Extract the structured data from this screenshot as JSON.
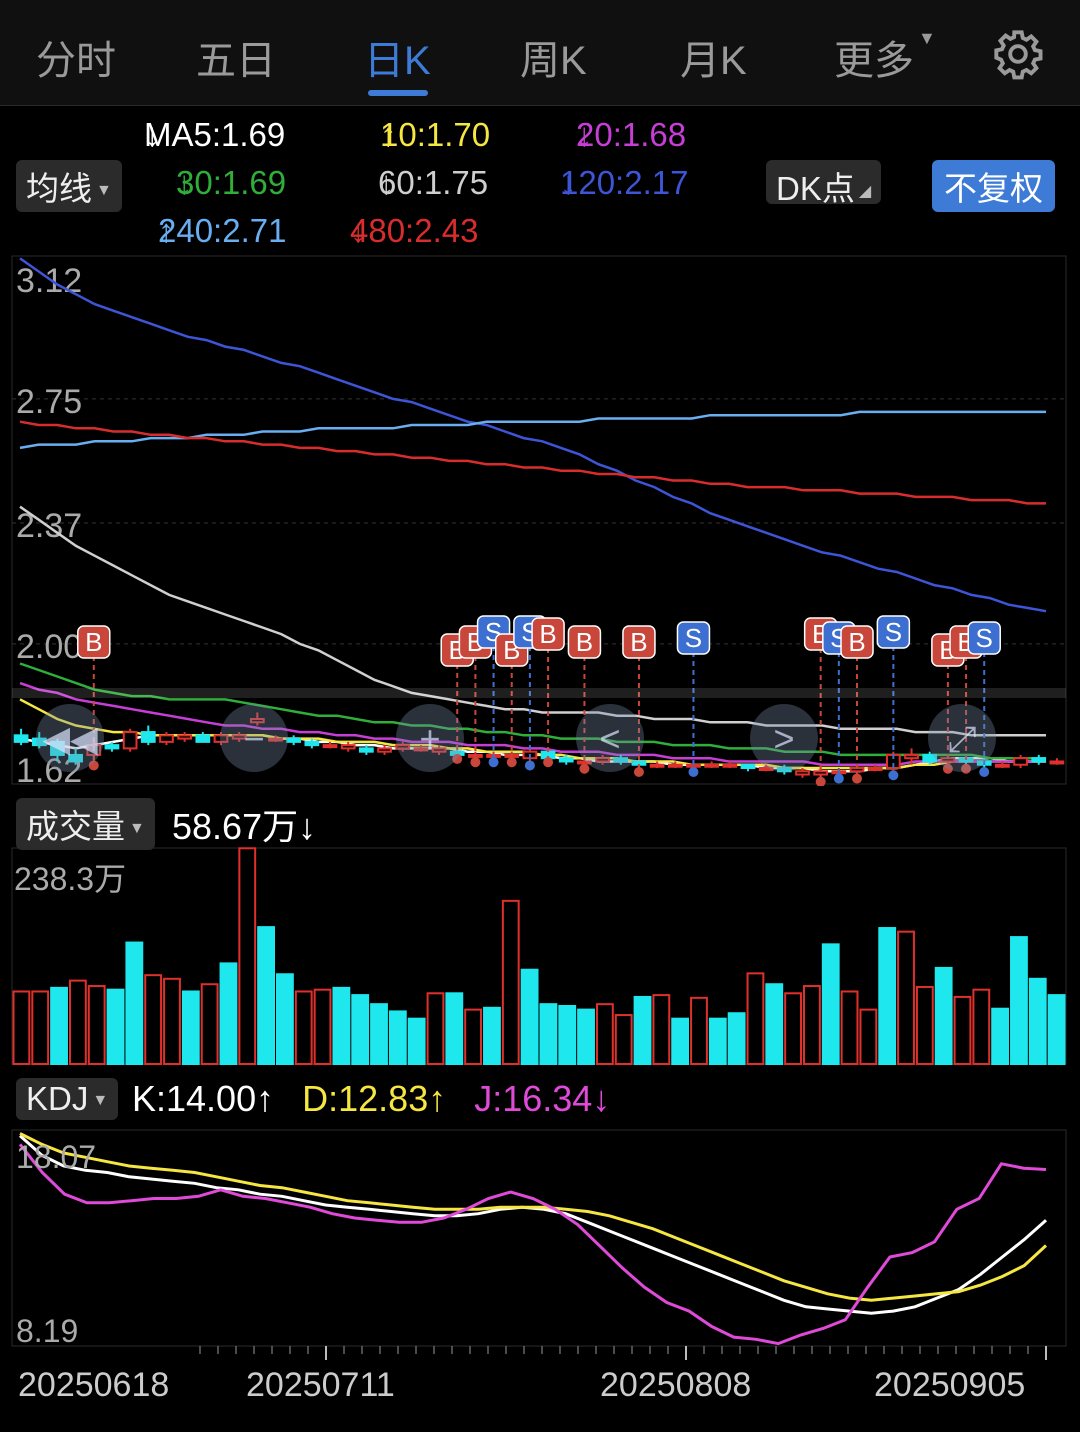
{
  "tabs": [
    {
      "label": "分时"
    },
    {
      "label": "五日"
    },
    {
      "label": "日K"
    },
    {
      "label": "周K"
    },
    {
      "label": "月K"
    },
    {
      "label": "更多"
    }
  ],
  "active_tab": "日K",
  "ma_selector": "均线",
  "ma_values": [
    {
      "label": "MA5:1.69",
      "arrow": "↓",
      "color": "#ffffff"
    },
    {
      "label": "10:1.70",
      "arrow": "↑",
      "color": "#f5e642"
    },
    {
      "label": "20:1.68",
      "arrow": "↓",
      "color": "#c73ed6"
    },
    {
      "label": "30:1.69",
      "arrow": "↓",
      "color": "#2fae3a"
    },
    {
      "label": "60:1.75",
      "arrow": "↓",
      "color": "#cfcfcf"
    },
    {
      "label": "120:2.17",
      "arrow": "↓",
      "color": "#3d55d6"
    },
    {
      "label": "240:2.71",
      "arrow": "↑",
      "color": "#6aaef2"
    },
    {
      "label": "480:2.43",
      "arrow": "↓",
      "color": "#d92d2d"
    }
  ],
  "dk_label": "DK点",
  "adjust_label": "不复权",
  "price_axis": [
    "3.12",
    "2.75",
    "2.37",
    "2.00",
    "1.62"
  ],
  "volume_selector": "成交量",
  "volume_value": "58.67万",
  "volume_arrow": "↓",
  "volume_max": "238.3万",
  "kdj_selector": "KDJ",
  "kdj": {
    "k": "K:14.00",
    "k_arrow": "↑",
    "d": "D:12.83",
    "d_arrow": "↑",
    "j": "J:16.34",
    "j_arrow": "↓"
  },
  "kdj_axis": [
    "18.07",
    "8.19"
  ],
  "dates": [
    "20250618",
    "20250711",
    "20250808",
    "20250905"
  ],
  "colors": {
    "up": "#e0302c",
    "down": "#1ee8ee",
    "accent": "#3d7bd6"
  },
  "chart_data": {
    "type": "candlestick",
    "price_range": [
      1.62,
      3.12
    ],
    "candles": [
      {
        "o": 1.72,
        "h": 1.74,
        "l": 1.69,
        "c": 1.7
      },
      {
        "o": 1.71,
        "h": 1.73,
        "l": 1.68,
        "c": 1.69
      },
      {
        "o": 1.7,
        "h": 1.71,
        "l": 1.64,
        "c": 1.66
      },
      {
        "o": 1.66,
        "h": 1.68,
        "l": 1.63,
        "c": 1.64
      },
      {
        "o": 1.66,
        "h": 1.71,
        "l": 1.64,
        "c": 1.69
      },
      {
        "o": 1.69,
        "h": 1.7,
        "l": 1.67,
        "c": 1.68
      },
      {
        "o": 1.68,
        "h": 1.74,
        "l": 1.67,
        "c": 1.73
      },
      {
        "o": 1.73,
        "h": 1.75,
        "l": 1.69,
        "c": 1.7
      },
      {
        "o": 1.7,
        "h": 1.73,
        "l": 1.69,
        "c": 1.72
      },
      {
        "o": 1.71,
        "h": 1.73,
        "l": 1.7,
        "c": 1.72
      },
      {
        "o": 1.72,
        "h": 1.73,
        "l": 1.7,
        "c": 1.7
      },
      {
        "o": 1.7,
        "h": 1.73,
        "l": 1.69,
        "c": 1.72
      },
      {
        "o": 1.71,
        "h": 1.73,
        "l": 1.7,
        "c": 1.72
      },
      {
        "o": 1.76,
        "h": 1.79,
        "l": 1.75,
        "c": 1.77
      },
      {
        "o": 1.71,
        "h": 1.72,
        "l": 1.7,
        "c": 1.71
      },
      {
        "o": 1.71,
        "h": 1.72,
        "l": 1.69,
        "c": 1.7
      },
      {
        "o": 1.7,
        "h": 1.71,
        "l": 1.68,
        "c": 1.69
      },
      {
        "o": 1.69,
        "h": 1.7,
        "l": 1.68,
        "c": 1.69
      },
      {
        "o": 1.68,
        "h": 1.7,
        "l": 1.67,
        "c": 1.69
      },
      {
        "o": 1.68,
        "h": 1.69,
        "l": 1.66,
        "c": 1.67
      },
      {
        "o": 1.67,
        "h": 1.69,
        "l": 1.66,
        "c": 1.68
      },
      {
        "o": 1.68,
        "h": 1.7,
        "l": 1.67,
        "c": 1.69
      },
      {
        "o": 1.68,
        "h": 1.69,
        "l": 1.67,
        "c": 1.68
      },
      {
        "o": 1.67,
        "h": 1.69,
        "l": 1.66,
        "c": 1.68
      },
      {
        "o": 1.67,
        "h": 1.68,
        "l": 1.66,
        "c": 1.66
      },
      {
        "o": 1.66,
        "h": 1.67,
        "l": 1.65,
        "c": 1.66
      },
      {
        "o": 1.66,
        "h": 1.67,
        "l": 1.65,
        "c": 1.66
      },
      {
        "o": 1.66,
        "h": 1.67,
        "l": 1.65,
        "c": 1.66
      },
      {
        "o": 1.65,
        "h": 1.68,
        "l": 1.64,
        "c": 1.67
      },
      {
        "o": 1.67,
        "h": 1.68,
        "l": 1.65,
        "c": 1.65
      },
      {
        "o": 1.65,
        "h": 1.66,
        "l": 1.63,
        "c": 1.64
      },
      {
        "o": 1.64,
        "h": 1.65,
        "l": 1.63,
        "c": 1.64
      },
      {
        "o": 1.64,
        "h": 1.66,
        "l": 1.63,
        "c": 1.65
      },
      {
        "o": 1.65,
        "h": 1.66,
        "l": 1.63,
        "c": 1.64
      },
      {
        "o": 1.64,
        "h": 1.64,
        "l": 1.62,
        "c": 1.63
      },
      {
        "o": 1.63,
        "h": 1.64,
        "l": 1.62,
        "c": 1.63
      },
      {
        "o": 1.63,
        "h": 1.64,
        "l": 1.62,
        "c": 1.63
      },
      {
        "o": 1.63,
        "h": 1.64,
        "l": 1.62,
        "c": 1.63
      },
      {
        "o": 1.63,
        "h": 1.64,
        "l": 1.62,
        "c": 1.63
      },
      {
        "o": 1.63,
        "h": 1.64,
        "l": 1.62,
        "c": 1.63
      },
      {
        "o": 1.63,
        "h": 1.63,
        "l": 1.61,
        "c": 1.62
      },
      {
        "o": 1.62,
        "h": 1.63,
        "l": 1.61,
        "c": 1.62
      },
      {
        "o": 1.62,
        "h": 1.63,
        "l": 1.6,
        "c": 1.61
      },
      {
        "o": 1.6,
        "h": 1.62,
        "l": 1.59,
        "c": 1.61
      },
      {
        "o": 1.6,
        "h": 1.62,
        "l": 1.59,
        "c": 1.61
      },
      {
        "o": 1.61,
        "h": 1.62,
        "l": 1.6,
        "c": 1.61
      },
      {
        "o": 1.61,
        "h": 1.63,
        "l": 1.6,
        "c": 1.62
      },
      {
        "o": 1.62,
        "h": 1.63,
        "l": 1.61,
        "c": 1.62
      },
      {
        "o": 1.62,
        "h": 1.67,
        "l": 1.61,
        "c": 1.66
      },
      {
        "o": 1.65,
        "h": 1.68,
        "l": 1.63,
        "c": 1.66
      },
      {
        "o": 1.66,
        "h": 1.67,
        "l": 1.63,
        "c": 1.64
      },
      {
        "o": 1.64,
        "h": 1.66,
        "l": 1.63,
        "c": 1.65
      },
      {
        "o": 1.65,
        "h": 1.66,
        "l": 1.63,
        "c": 1.64
      },
      {
        "o": 1.64,
        "h": 1.65,
        "l": 1.62,
        "c": 1.63
      },
      {
        "o": 1.63,
        "h": 1.64,
        "l": 1.62,
        "c": 1.63
      },
      {
        "o": 1.63,
        "h": 1.66,
        "l": 1.62,
        "c": 1.65
      },
      {
        "o": 1.65,
        "h": 1.66,
        "l": 1.63,
        "c": 1.64
      },
      {
        "o": 1.64,
        "h": 1.65,
        "l": 1.63,
        "c": 1.64
      }
    ],
    "volume_max": 238.3,
    "volumes": [
      80,
      80,
      84,
      92,
      86,
      82,
      134,
      98,
      94,
      80,
      88,
      111,
      238,
      151,
      99,
      80,
      82,
      84,
      76,
      66,
      58,
      50,
      78,
      78,
      60,
      62,
      180,
      104,
      66,
      64,
      60,
      66,
      54,
      74,
      76,
      50,
      73,
      50,
      56,
      100,
      88,
      78,
      86,
      132,
      80,
      60,
      150,
      146,
      85,
      106,
      74,
      82,
      61,
      140,
      94,
      76
    ],
    "volume_up": [
      1,
      1,
      0,
      1,
      1,
      0,
      0,
      1,
      1,
      0,
      1,
      0,
      1,
      0,
      0,
      1,
      1,
      0,
      0,
      0,
      0,
      0,
      1,
      0,
      1,
      0,
      1,
      0,
      0,
      0,
      0,
      1,
      1,
      0,
      1,
      0,
      1,
      0,
      0,
      1,
      0,
      1,
      1,
      0,
      1,
      1,
      0,
      1,
      1,
      0,
      1,
      1,
      0,
      0,
      0,
      0
    ],
    "ma_lines": {
      "MA5": [
        1.71,
        1.7,
        1.69,
        1.68,
        1.69,
        1.7,
        1.71,
        1.72,
        1.72,
        1.72,
        1.72,
        1.72,
        1.72,
        1.72,
        1.71,
        1.71,
        1.7,
        1.7,
        1.69,
        1.69,
        1.68,
        1.68,
        1.68,
        1.68,
        1.67,
        1.67,
        1.66,
        1.66,
        1.66,
        1.65,
        1.65,
        1.64,
        1.64,
        1.64,
        1.64,
        1.63,
        1.63,
        1.63,
        1.63,
        1.63,
        1.62,
        1.62,
        1.62,
        1.61,
        1.61,
        1.61,
        1.62,
        1.62,
        1.63,
        1.64,
        1.65,
        1.65,
        1.65,
        1.64,
        1.64,
        1.64
      ],
      "MA10": [
        1.83,
        1.8,
        1.77,
        1.75,
        1.74,
        1.73,
        1.73,
        1.72,
        1.72,
        1.72,
        1.72,
        1.72,
        1.72,
        1.72,
        1.71,
        1.71,
        1.71,
        1.7,
        1.7,
        1.7,
        1.69,
        1.69,
        1.69,
        1.68,
        1.68,
        1.67,
        1.67,
        1.67,
        1.66,
        1.66,
        1.65,
        1.65,
        1.65,
        1.64,
        1.64,
        1.64,
        1.63,
        1.63,
        1.63,
        1.63,
        1.63,
        1.62,
        1.62,
        1.62,
        1.62,
        1.62,
        1.62,
        1.62,
        1.63,
        1.63,
        1.64,
        1.64,
        1.64,
        1.64,
        1.64,
        1.64
      ],
      "MA20": [
        1.88,
        1.86,
        1.85,
        1.83,
        1.82,
        1.81,
        1.8,
        1.79,
        1.78,
        1.77,
        1.76,
        1.75,
        1.75,
        1.74,
        1.74,
        1.73,
        1.73,
        1.72,
        1.72,
        1.71,
        1.71,
        1.7,
        1.7,
        1.7,
        1.69,
        1.69,
        1.69,
        1.68,
        1.68,
        1.67,
        1.67,
        1.67,
        1.66,
        1.66,
        1.66,
        1.65,
        1.65,
        1.65,
        1.64,
        1.64,
        1.64,
        1.64,
        1.64,
        1.63,
        1.63,
        1.63,
        1.63,
        1.63,
        1.64,
        1.64,
        1.64,
        1.64,
        1.64,
        1.64,
        1.64,
        1.64
      ],
      "MA30": [
        1.94,
        1.92,
        1.9,
        1.88,
        1.86,
        1.85,
        1.84,
        1.84,
        1.83,
        1.83,
        1.83,
        1.83,
        1.82,
        1.81,
        1.8,
        1.79,
        1.78,
        1.78,
        1.77,
        1.76,
        1.76,
        1.75,
        1.75,
        1.74,
        1.74,
        1.73,
        1.73,
        1.72,
        1.72,
        1.71,
        1.71,
        1.71,
        1.7,
        1.7,
        1.7,
        1.69,
        1.69,
        1.69,
        1.68,
        1.68,
        1.68,
        1.67,
        1.67,
        1.67,
        1.66,
        1.66,
        1.66,
        1.66,
        1.66,
        1.66,
        1.66,
        1.66,
        1.65,
        1.65,
        1.65,
        1.65
      ],
      "MA60": [
        2.42,
        2.38,
        2.34,
        2.3,
        2.27,
        2.24,
        2.21,
        2.18,
        2.15,
        2.13,
        2.11,
        2.09,
        2.07,
        2.05,
        2.03,
        2.0,
        1.98,
        1.95,
        1.92,
        1.89,
        1.87,
        1.85,
        1.84,
        1.83,
        1.82,
        1.81,
        1.8,
        1.8,
        1.79,
        1.79,
        1.79,
        1.79,
        1.78,
        1.78,
        1.77,
        1.77,
        1.77,
        1.76,
        1.76,
        1.76,
        1.75,
        1.75,
        1.75,
        1.75,
        1.74,
        1.74,
        1.74,
        1.74,
        1.73,
        1.73,
        1.73,
        1.72,
        1.72,
        1.72,
        1.72,
        1.72
      ],
      "MA120": [
        3.18,
        3.14,
        3.1,
        3.07,
        3.04,
        3.02,
        3.0,
        2.98,
        2.96,
        2.94,
        2.93,
        2.91,
        2.9,
        2.88,
        2.86,
        2.85,
        2.83,
        2.81,
        2.79,
        2.77,
        2.75,
        2.74,
        2.72,
        2.7,
        2.68,
        2.67,
        2.65,
        2.63,
        2.62,
        2.6,
        2.58,
        2.55,
        2.53,
        2.5,
        2.48,
        2.45,
        2.43,
        2.4,
        2.38,
        2.36,
        2.34,
        2.32,
        2.3,
        2.28,
        2.27,
        2.25,
        2.23,
        2.22,
        2.2,
        2.18,
        2.17,
        2.15,
        2.14,
        2.12,
        2.11,
        2.1
      ],
      "MA240": [
        2.6,
        2.61,
        2.61,
        2.61,
        2.62,
        2.62,
        2.62,
        2.63,
        2.63,
        2.63,
        2.64,
        2.64,
        2.64,
        2.65,
        2.65,
        2.65,
        2.66,
        2.66,
        2.66,
        2.66,
        2.66,
        2.67,
        2.67,
        2.67,
        2.67,
        2.68,
        2.68,
        2.68,
        2.68,
        2.68,
        2.68,
        2.69,
        2.69,
        2.69,
        2.69,
        2.69,
        2.69,
        2.7,
        2.7,
        2.7,
        2.7,
        2.7,
        2.7,
        2.7,
        2.7,
        2.71,
        2.71,
        2.71,
        2.71,
        2.71,
        2.71,
        2.71,
        2.71,
        2.71,
        2.71,
        2.71
      ],
      "MA480": [
        2.68,
        2.67,
        2.67,
        2.66,
        2.66,
        2.65,
        2.65,
        2.64,
        2.64,
        2.63,
        2.63,
        2.62,
        2.62,
        2.61,
        2.61,
        2.6,
        2.6,
        2.59,
        2.59,
        2.58,
        2.58,
        2.57,
        2.57,
        2.56,
        2.56,
        2.55,
        2.55,
        2.54,
        2.54,
        2.53,
        2.53,
        2.52,
        2.52,
        2.51,
        2.51,
        2.5,
        2.5,
        2.49,
        2.49,
        2.48,
        2.48,
        2.48,
        2.47,
        2.47,
        2.47,
        2.46,
        2.46,
        2.46,
        2.45,
        2.45,
        2.45,
        2.44,
        2.44,
        2.44,
        2.43,
        2.43
      ]
    },
    "signals": [
      {
        "i": 4,
        "t": "B"
      },
      {
        "i": 24,
        "t": "B"
      },
      {
        "i": 25,
        "t": "B"
      },
      {
        "i": 26,
        "t": "S"
      },
      {
        "i": 27,
        "t": "B"
      },
      {
        "i": 28,
        "t": "S"
      },
      {
        "i": 29,
        "t": "B"
      },
      {
        "i": 31,
        "t": "B"
      },
      {
        "i": 34,
        "t": "B"
      },
      {
        "i": 37,
        "t": "S"
      },
      {
        "i": 44,
        "t": "B"
      },
      {
        "i": 45,
        "t": "S"
      },
      {
        "i": 46,
        "t": "B"
      },
      {
        "i": 48,
        "t": "S"
      },
      {
        "i": 51,
        "t": "B"
      },
      {
        "i": 52,
        "t": "B"
      },
      {
        "i": 53,
        "t": "S"
      }
    ],
    "kdj_range": [
      8.19,
      18.07
    ],
    "kdj_lines": {
      "K": [
        17.9,
        17.0,
        16.5,
        16.3,
        16.2,
        16.0,
        15.9,
        15.8,
        15.7,
        15.5,
        15.4,
        15.2,
        15.1,
        14.9,
        14.7,
        14.6,
        14.5,
        14.4,
        14.3,
        14.2,
        14.2,
        14.3,
        14.5,
        14.6,
        14.5,
        14.3,
        13.9,
        13.5,
        13.1,
        12.7,
        12.3,
        11.9,
        11.5,
        11.1,
        10.7,
        10.3,
        10.0,
        9.9,
        9.8,
        9.7,
        9.8,
        10.0,
        10.4,
        10.8,
        11.5,
        12.3,
        13.1,
        14.0
      ],
      "D": [
        18.0,
        17.5,
        17.1,
        16.9,
        16.7,
        16.5,
        16.4,
        16.3,
        16.2,
        16.0,
        15.8,
        15.6,
        15.5,
        15.3,
        15.1,
        14.9,
        14.8,
        14.7,
        14.6,
        14.5,
        14.5,
        14.5,
        14.6,
        14.6,
        14.6,
        14.5,
        14.4,
        14.2,
        13.9,
        13.6,
        13.2,
        12.8,
        12.4,
        12.0,
        11.6,
        11.2,
        10.9,
        10.6,
        10.4,
        10.3,
        10.4,
        10.5,
        10.6,
        10.7,
        11.0,
        11.4,
        11.9,
        12.83
      ],
      "J": [
        17.5,
        16.2,
        15.2,
        14.8,
        14.8,
        14.9,
        15.0,
        15.0,
        15.1,
        15.4,
        15.1,
        15.0,
        14.8,
        14.6,
        14.3,
        14.1,
        14.0,
        13.9,
        13.9,
        14.1,
        14.5,
        15.0,
        15.3,
        15.0,
        14.5,
        13.8,
        12.8,
        11.8,
        10.9,
        10.2,
        9.8,
        9.1,
        8.6,
        8.5,
        8.3,
        8.7,
        9.0,
        9.4,
        10.9,
        12.3,
        12.5,
        13.0,
        14.5,
        15.0,
        16.6,
        16.4,
        16.34
      ]
    },
    "dates": [
      "20250618",
      "20250711",
      "20250808",
      "20250905"
    ]
  }
}
